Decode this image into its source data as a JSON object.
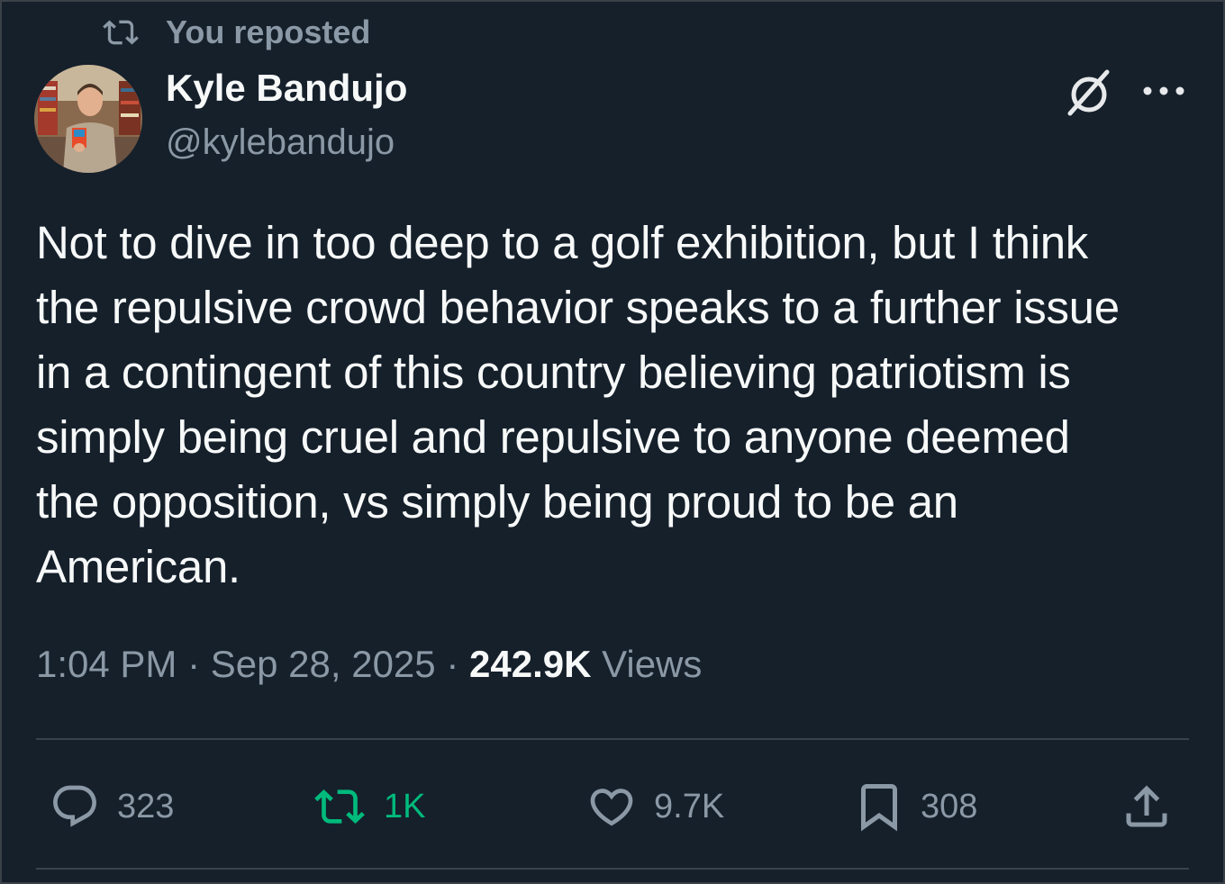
{
  "repost_banner": {
    "label": "You reposted"
  },
  "author": {
    "name": "Kyle Bandujo",
    "handle": "@kylebandujo"
  },
  "tweet": {
    "lines": [
      "Not to dive in too deep to a golf exhibition, but I think",
      "the repulsive crowd behavior speaks to a further issue",
      "in a contingent of this country believing patriotism is",
      "simply being cruel and repulsive to anyone deemed",
      "the opposition, vs simply being proud to be an",
      "American."
    ],
    "time": "1:04 PM",
    "separator": "·",
    "date": "Sep 28, 2025",
    "views_count": "242.9K",
    "views_label": "Views"
  },
  "actions": {
    "replies": "323",
    "reposts": "1K",
    "likes": "9.7K",
    "bookmarks": "308"
  },
  "icons": {
    "repost_banner": "repost-icon",
    "grok": "grok-icon",
    "more": "more-dots-icon",
    "reply": "reply-icon",
    "repost": "repost-icon",
    "like": "heart-icon",
    "bookmark": "bookmark-icon",
    "share": "share-icon"
  },
  "colors": {
    "background": "#15202b",
    "text_primary": "#f7f9f9",
    "text_secondary": "#8b98a5",
    "repost_active": "#00ba7c",
    "divider": "#38444d"
  }
}
